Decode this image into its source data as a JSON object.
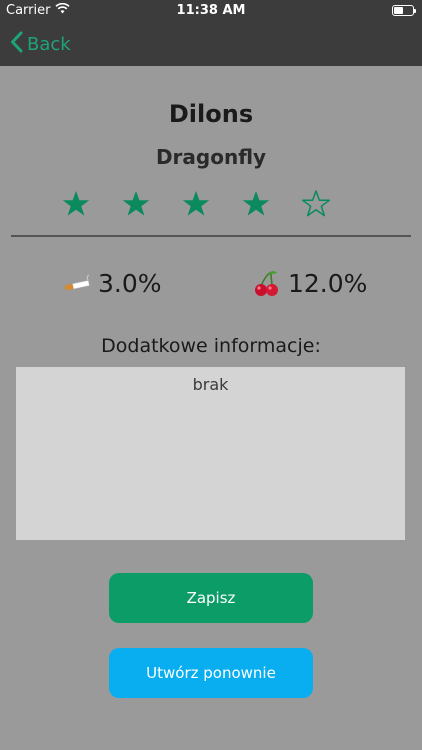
{
  "status_bar": {
    "carrier": "Carrier",
    "time": "11:38 AM",
    "battery_level": 0.5
  },
  "nav": {
    "back_label": "Back"
  },
  "product": {
    "name": "Dilons",
    "flavor": "Dragonfly",
    "rating": 4,
    "rating_max": 5
  },
  "stats": {
    "nicotine": "3.0%",
    "fruit": "12.0%"
  },
  "icons": {
    "wifi": "wifi-icon",
    "back": "chevron-left-icon",
    "star_filled": "star-filled-icon",
    "star_empty": "star-outline-icon",
    "nicotine": "cigarette-icon",
    "fruit": "cherries-icon"
  },
  "info": {
    "label": "Dodatkowe informacje:",
    "value": "brak"
  },
  "buttons": {
    "save": "Zapisz",
    "recreate": "Utwórz ponownie"
  },
  "colors": {
    "accent": "#1fa37a",
    "star": "#0b8a5e",
    "save_button": "#0b9c67",
    "recreate_button": "#08aef0",
    "background": "#9a9a9a",
    "header": "#3c3c3c"
  }
}
